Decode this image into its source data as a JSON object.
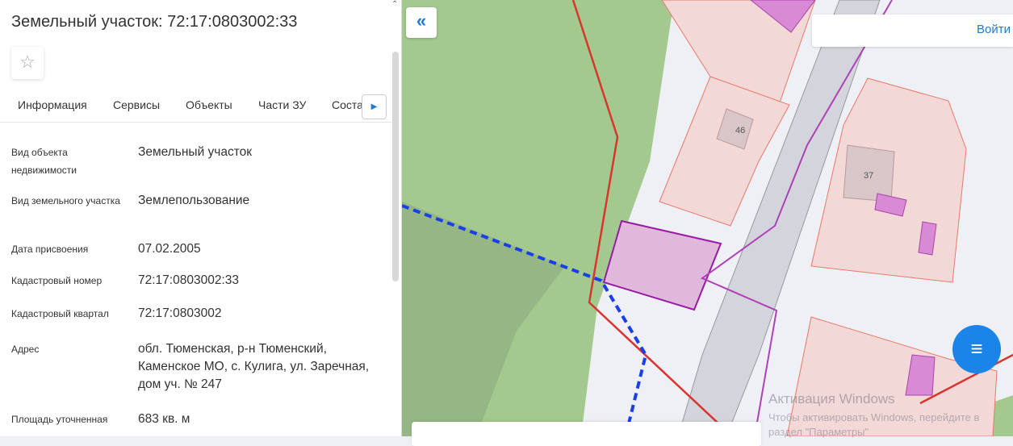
{
  "panel": {
    "title": "Земельный участок: 72:17:0803002:33",
    "favorite_icon": "star-icon",
    "tabs": [
      "Информация",
      "Сервисы",
      "Объекты",
      "Части ЗУ",
      "Соста"
    ],
    "fields": [
      {
        "label": "Вид объекта недвижимости",
        "value": "Земельный участок"
      },
      {
        "label": "Вид земельного участка",
        "value": "Землепользование"
      },
      {
        "label": "Дата присвоения",
        "value": "07.02.2005"
      },
      {
        "label": "Кадастровый номер",
        "value": "72:17:0803002:33"
      },
      {
        "label": "Кадастровый квартал",
        "value": "72:17:0803002"
      },
      {
        "label": "Адрес",
        "value": "обл. Тюменская, р-н Тюменский, Каменское МО, с. Кулига, ул. Заречная, дом уч. № 247"
      },
      {
        "label": "Площадь уточненная",
        "value": "683 кв. м"
      }
    ]
  },
  "map": {
    "login": "Войти",
    "collapse": "«",
    "labels": [
      "46",
      "37"
    ],
    "watermark": {
      "title": "Активация Windows",
      "line1": "Чтобы активировать Windows, перейдите в",
      "line2": "раздел \"Параметры\""
    }
  }
}
